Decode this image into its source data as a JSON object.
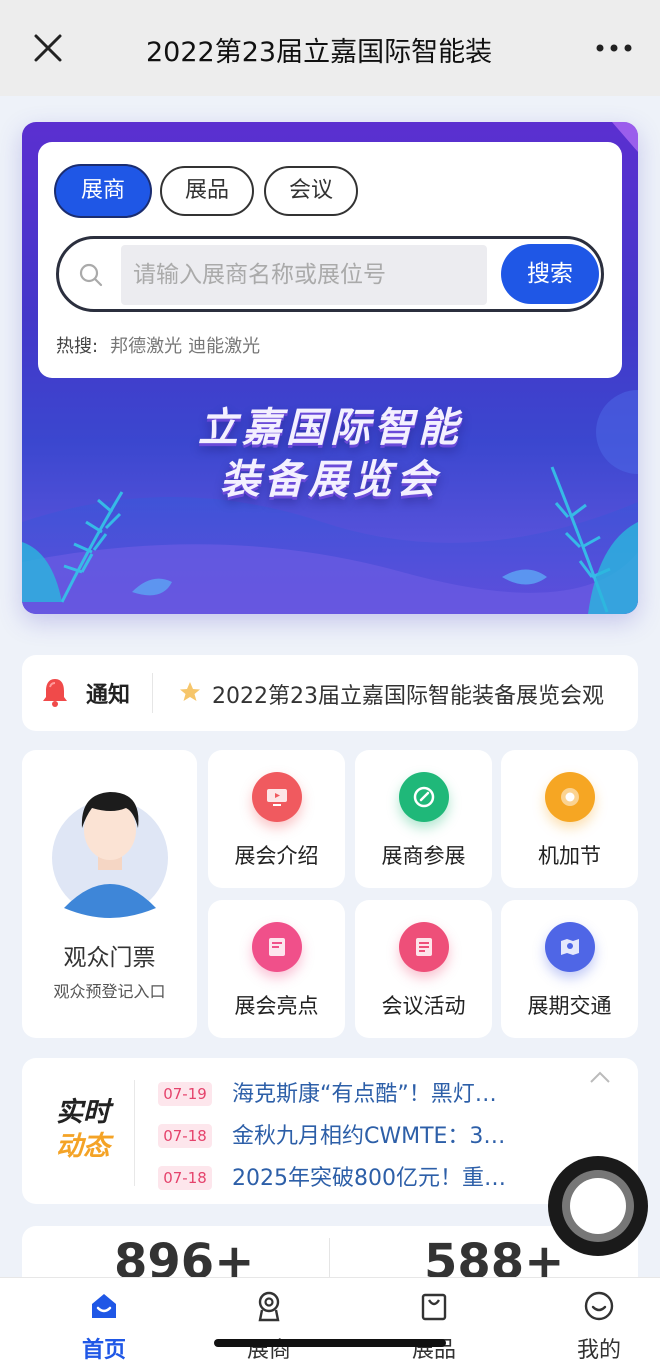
{
  "topbar": {
    "title": "2022第23届立嘉国际智能装"
  },
  "banner": {
    "headline_line1": "立嘉国际智能",
    "headline_line2": "装备展览会"
  },
  "search": {
    "tabs": [
      {
        "label": "展商"
      },
      {
        "label": "展品"
      },
      {
        "label": "会议"
      }
    ],
    "placeholder": "请输入展商名称或展位号",
    "button": "搜索",
    "hot_label": "热搜:",
    "hot_keywords": [
      "邦德激光",
      "迪能激光"
    ]
  },
  "notice": {
    "label": "通知",
    "text": "2022第23届立嘉国际智能装备展览会观"
  },
  "ticket": {
    "title": "观众门票",
    "subtitle": "观众预登记入口"
  },
  "tiles": [
    {
      "label": "展会介绍",
      "color": "#f05a5f"
    },
    {
      "label": "展商参展",
      "color": "#1fb879"
    },
    {
      "label": "机加节",
      "color": "#f6a623"
    },
    {
      "label": "展会亮点",
      "color": "#f0508a"
    },
    {
      "label": "会议活动",
      "color": "#ee4f79"
    },
    {
      "label": "展期交通",
      "color": "#4f66e6"
    }
  ],
  "live": {
    "logo_line1": "实时",
    "logo_line2": "动态",
    "news": [
      {
        "date": "07-19",
        "title": "海克斯康“有点酷”！黑灯…"
      },
      {
        "date": "07-18",
        "title": "金秋九月相约CWMTE：3…"
      },
      {
        "date": "07-18",
        "title": "2025年突破800亿元！重…"
      }
    ]
  },
  "stats": {
    "left": "896+",
    "right": "588+"
  },
  "tabbar": [
    {
      "label": "首页"
    },
    {
      "label": "展商"
    },
    {
      "label": "展品"
    },
    {
      "label": "我的"
    }
  ],
  "colors": {
    "accent": "#1f57e6",
    "date_badge": "#e5436c",
    "news_link": "#2d5fa8"
  }
}
